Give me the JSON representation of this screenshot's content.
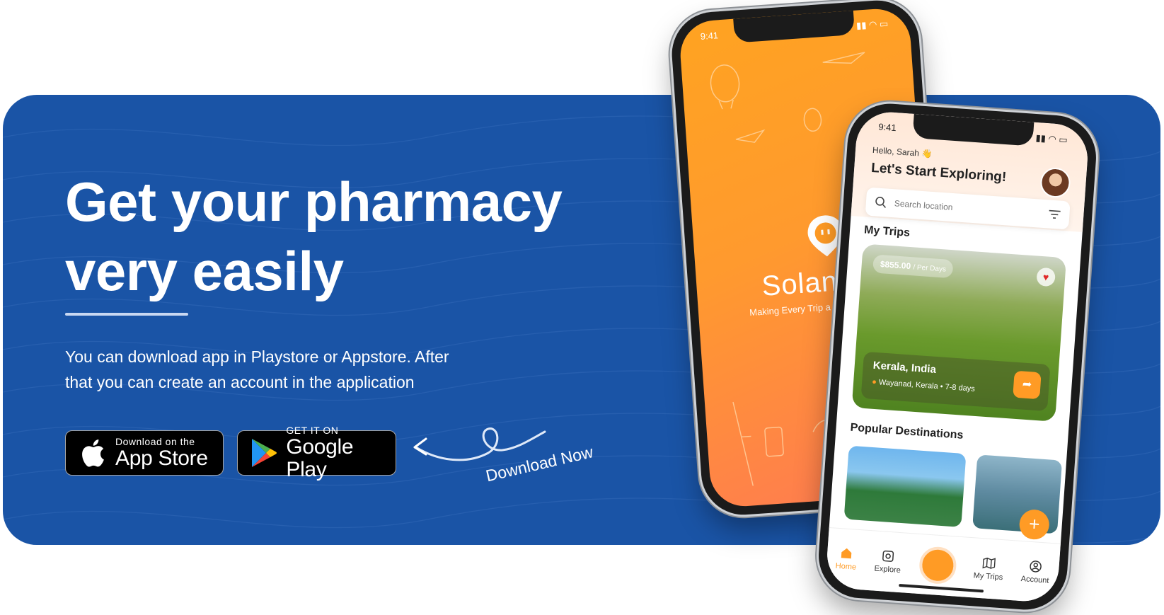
{
  "banner": {
    "headline_line1": "Get your pharmacy",
    "headline_line2": "very easily",
    "description": "You can download app  in Playstore or Appstore. After that you can create an account in the application",
    "background_color": "#1a54a6"
  },
  "store_buttons": {
    "apple_small": "Download on the",
    "apple_big": "App Store",
    "google_small": "GET IT ON",
    "google_big": "Google Play"
  },
  "cta": {
    "label": "Download Now"
  },
  "back_phone": {
    "time": "9:41",
    "app_name": "Solange",
    "tagline": "Making Every Trip a Tailor"
  },
  "front_phone": {
    "time": "9:41",
    "greeting": "Hello, Sarah 👋",
    "title": "Let's Start Exploring!",
    "search_placeholder": "Search location",
    "my_trips_title": "My Trips",
    "trip": {
      "price": "$855.00",
      "price_unit": "/ Per Days",
      "name": "Kerala, India",
      "location": "Wayanad, Kerala",
      "duration": "• 7-8 days"
    },
    "popular_title": "Popular Destinations",
    "tabs": [
      {
        "label": "Home"
      },
      {
        "label": "Explore"
      },
      {
        "label": "My Trips"
      },
      {
        "label": "Account"
      }
    ],
    "accent_color": "#ff9b25"
  }
}
